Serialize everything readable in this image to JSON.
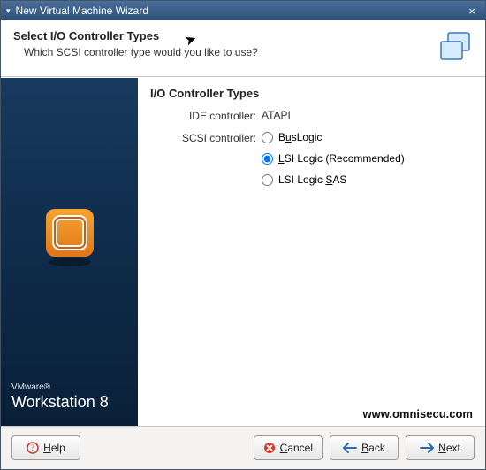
{
  "titlebar": {
    "title": "New Virtual Machine Wizard"
  },
  "header": {
    "heading": "Select I/O Controller Types",
    "desc": "Which SCSI controller type would you like to use?"
  },
  "sidepanel": {
    "brand_small": "VMware®",
    "brand_big": "Workstation 8"
  },
  "main": {
    "section_title": "I/O Controller Types",
    "ide_label": "IDE controller:",
    "ide_value": "ATAPI",
    "scsi_label": "SCSI controller:",
    "options": {
      "buslogic_pre": "B",
      "buslogic_mn": "u",
      "buslogic_post": "sLogic",
      "lsi_pre": "",
      "lsi_mn": "L",
      "lsi_post": "SI Logic (Recommended)",
      "sas_pre": "LSI Logic ",
      "sas_mn": "S",
      "sas_post": "AS"
    },
    "watermark": "www.omnisecu.com"
  },
  "footer": {
    "help_mn": "H",
    "help_post": "elp",
    "cancel_mn": "C",
    "cancel_post": "ancel",
    "back_mn": "B",
    "back_post": "ack",
    "next_mn": "N",
    "next_post": "ext"
  }
}
